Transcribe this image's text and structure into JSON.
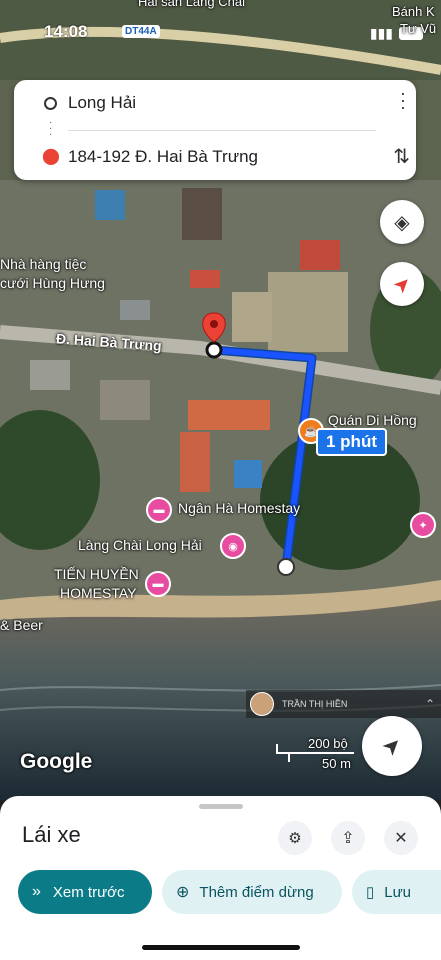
{
  "status_bar": {
    "time": "14:08",
    "route_chip": "DT44A"
  },
  "directions": {
    "origin": "Long Hải",
    "destination": "184-192 Đ. Hai Bà Trưng"
  },
  "map": {
    "street_label": "Đ. Hai Bà Trưng",
    "eta_label": "1 phút",
    "places": {
      "restaurant": "Nhà hàng tiệc cưới Hùng Hưng",
      "restaurant_line1": "Nhà hàng tiệc",
      "restaurant_line2": "cưới Hùng Hưng",
      "cafe": "Quán Di Hồng",
      "homestay": "Ngân Hà Homestay",
      "village": "Làng Chài Long Hải",
      "tien_huyen_line1": "TIẾN HUYỀN",
      "tien_huyen_line2": "HOMESTAY",
      "beer": "& Beer",
      "top_left": "Hải sản Làng Chài",
      "top_right_1": "Bánh K",
      "top_right_2": "Tư Vũ"
    },
    "contributor": "TRẦN THỊ HIỀN",
    "attribution": "Google",
    "scale_imperial": "200 bộ",
    "scale_metric": "50 m"
  },
  "bottom_sheet": {
    "mode_title": "Lái xe",
    "preview_label": "Xem trước",
    "add_stop_label": "Thêm điểm dừng",
    "save_label": "Lưu"
  },
  "colors": {
    "route": "#1a73e8",
    "primary": "#0b7c87",
    "pin": "#ea4335"
  }
}
